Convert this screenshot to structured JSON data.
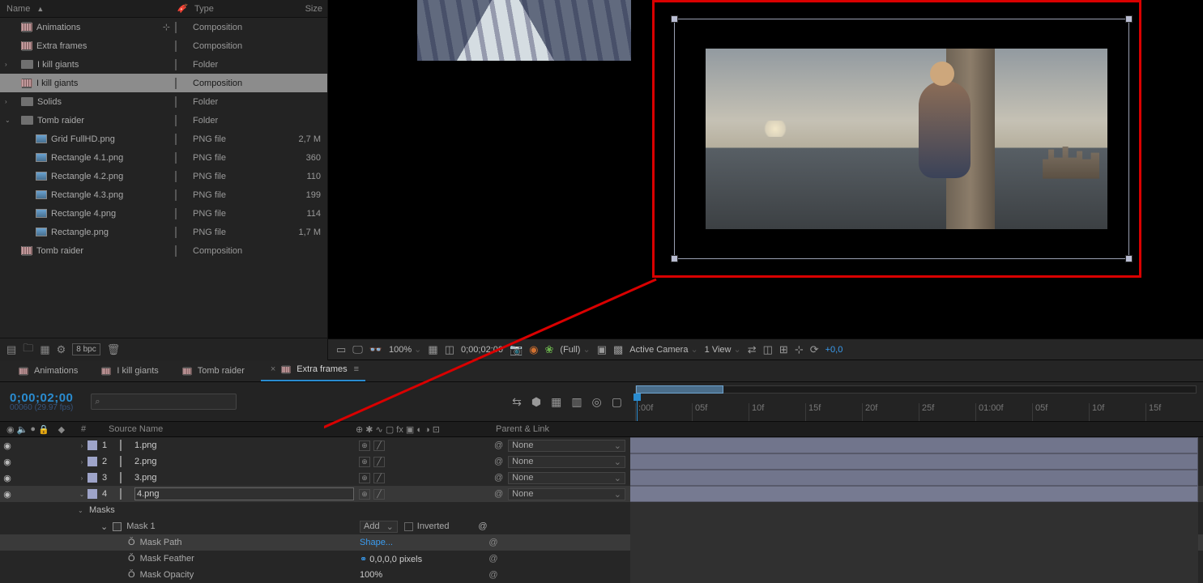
{
  "project": {
    "cols": {
      "name": "Name",
      "tag": "",
      "type": "Type",
      "size": "Size"
    },
    "items": [
      {
        "indent": 0,
        "exp": "",
        "icon": "comp",
        "name": "Animations",
        "tag": "#232323",
        "type": "Composition",
        "size": "",
        "flow": true
      },
      {
        "indent": 0,
        "exp": "",
        "icon": "comp",
        "name": "Extra frames",
        "tag": "#232323",
        "type": "Composition",
        "size": ""
      },
      {
        "indent": 0,
        "exp": ">",
        "icon": "folder",
        "name": "I kill giants",
        "tag": "#c9a31a",
        "type": "Folder",
        "size": ""
      },
      {
        "indent": 0,
        "exp": "",
        "icon": "comp",
        "name": "I kill giants",
        "tag": "#232323",
        "type": "Composition",
        "size": "",
        "sel": true
      },
      {
        "indent": 0,
        "exp": ">",
        "icon": "folder",
        "name": "Solids",
        "tag": "#c9a31a",
        "type": "Folder",
        "size": ""
      },
      {
        "indent": 0,
        "exp": "v",
        "icon": "folder",
        "name": "Tomb raider",
        "tag": "#c9a31a",
        "type": "Folder",
        "size": ""
      },
      {
        "indent": 1,
        "exp": "",
        "icon": "image",
        "name": "Grid FullHD.png",
        "tag": "#9ea4c9",
        "type": "PNG file",
        "size": "2,7 M"
      },
      {
        "indent": 1,
        "exp": "",
        "icon": "image",
        "name": "Rectangle 4.1.png",
        "tag": "#9ea4c9",
        "type": "PNG file",
        "size": "360"
      },
      {
        "indent": 1,
        "exp": "",
        "icon": "image",
        "name": "Rectangle 4.2.png",
        "tag": "#9ea4c9",
        "type": "PNG file",
        "size": "110"
      },
      {
        "indent": 1,
        "exp": "",
        "icon": "image",
        "name": "Rectangle 4.3.png",
        "tag": "#9ea4c9",
        "type": "PNG file",
        "size": "199"
      },
      {
        "indent": 1,
        "exp": "",
        "icon": "image",
        "name": "Rectangle 4.png",
        "tag": "#9ea4c9",
        "type": "PNG file",
        "size": "114"
      },
      {
        "indent": 1,
        "exp": "",
        "icon": "image",
        "name": "Rectangle.png",
        "tag": "#9ea4c9",
        "type": "PNG file",
        "size": "1,7 M"
      },
      {
        "indent": 0,
        "exp": "",
        "icon": "comp",
        "name": "Tomb raider",
        "tag": "#232323",
        "type": "Composition",
        "size": ""
      }
    ],
    "bpc": "8 bpc"
  },
  "viewerbar": {
    "zoom": "100%",
    "time": "0;00;02;00",
    "res": "(Full)",
    "camera": "Active Camera",
    "views": "1 View",
    "exposure": "+0,0"
  },
  "tabs": [
    "Animations",
    "I kill giants",
    "Tomb raider",
    "Extra frames"
  ],
  "activeTab": 3,
  "timecode": "0;00;02;00",
  "timecodeSub": "00060 (29.97 fps)",
  "searchPlaceholder": "",
  "columns": {
    "num": "#",
    "src": "Source Name",
    "parent": "Parent & Link"
  },
  "layers": [
    {
      "num": "1",
      "name": "1.png",
      "parent": "None"
    },
    {
      "num": "2",
      "name": "2.png",
      "parent": "None"
    },
    {
      "num": "3",
      "name": "3.png",
      "parent": "None"
    },
    {
      "num": "4",
      "name": "4.png",
      "parent": "None",
      "sel": true
    }
  ],
  "masks": {
    "group": "Masks",
    "name": "Mask 1",
    "mode": "Add",
    "inverted": "Inverted",
    "props": [
      {
        "label": "Mask Path",
        "value": "Shape...",
        "blue": true,
        "sel": true
      },
      {
        "label": "Mask Feather",
        "value": "0,0,0,0",
        "unit": " pixels",
        "link": true
      },
      {
        "label": "Mask Opacity",
        "value": "100",
        "unit": "%"
      }
    ]
  },
  "ruler": [
    ":00f",
    "05f",
    "10f",
    "15f",
    "20f",
    "25f",
    "01:00f",
    "05f",
    "10f",
    "15f"
  ]
}
